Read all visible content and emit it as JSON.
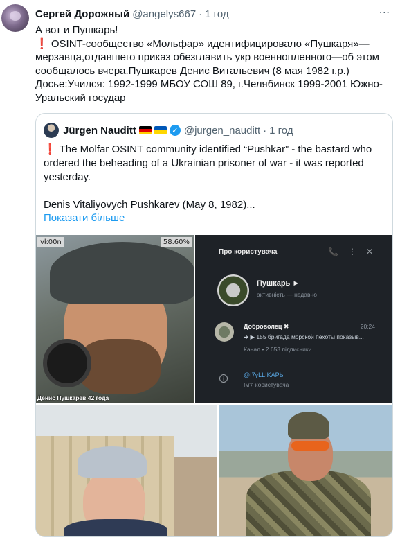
{
  "tweet": {
    "author_name": "Сергей Дорожный",
    "author_handle": "@angelys667",
    "separator": "·",
    "time": "1 год",
    "more_icon": "⋯",
    "lines": [
      "А вот и Пушкарь!",
      "OSINT-сообщество «Мольфар» идентифицировало «Пушкаря»— мерзавца,отдавшего приказ обезглавить укр военнопленного—об этом сообщалось вчера.Пушкарев Денис Витальевич (8 мая 1982 г.р.)",
      "Досье:Учился: 1992-1999 МБОУ СОШ 89, г.Челябинск 1999-2001 Южно-Уральский государ"
    ],
    "exclamation": "❗"
  },
  "quote": {
    "author_name": "Jürgen Nauditt",
    "author_handle": "@jurgen_nauditt",
    "separator": "·",
    "time": "1 год",
    "verified_mark": "✓",
    "exclamation": "❗",
    "line1": "The Molfar OSINT community identified “Pushkar” - the bastard who ordered the beheading of a Ukrainian prisoner of war - it was reported yesterday.",
    "line2": "Denis Vitaliyovych Pushkarev (May 8, 1982)...",
    "show_more": "Показати більше"
  },
  "media": {
    "photo1": {
      "tag_left": "vk00n",
      "tag_right": "58.60%",
      "caption": "Денис Пушкарёв 42 года"
    },
    "telegram": {
      "title": "Про користувача",
      "icons": "📞⋮✕",
      "name": "Пушкарь",
      "name_flag": "►",
      "status": "активність — недавно",
      "channel_name": "Доброволец",
      "channel_flag": "✖",
      "channel_time": "20:24",
      "channel_msg": "➜ ▶ 155 бригада морской пехоты показыв...",
      "channel_sub": "Канал • 2 653 підписники",
      "info_icon": "i",
      "username": "@I7yLLIKAPЬ",
      "username_label": "Ім'я користувача"
    }
  },
  "colors": {
    "link": "#1d9bf0",
    "secondary_text": "#536471",
    "border": "#cfd9de"
  }
}
